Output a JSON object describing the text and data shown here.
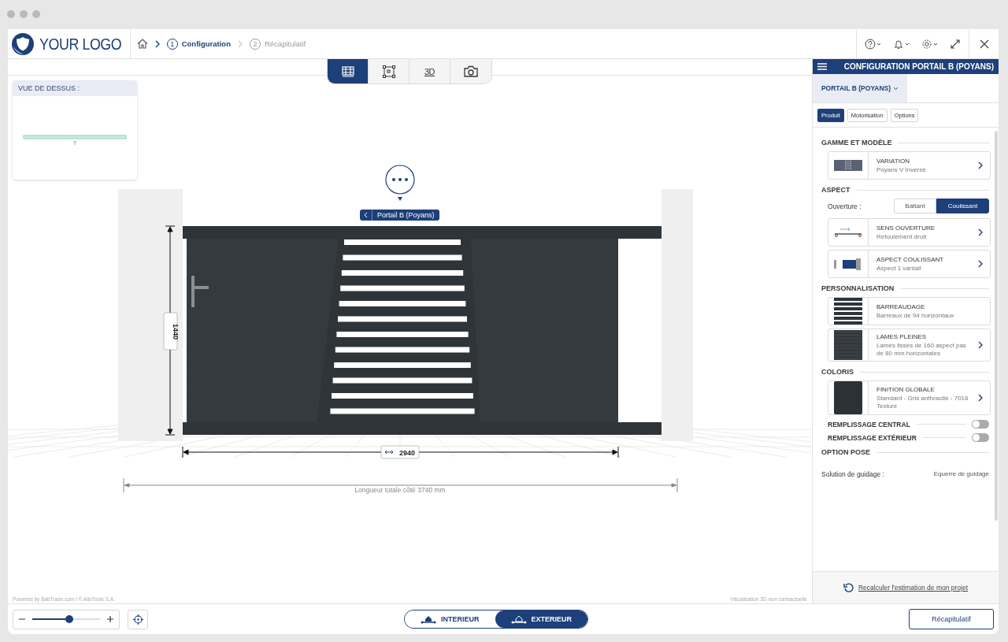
{
  "header": {
    "logo_text": "YOUR LOGO",
    "steps": [
      {
        "number": "1",
        "label": "Configuration",
        "selected": true
      },
      {
        "number": "2",
        "label": "Récapitulatif",
        "selected": false
      }
    ]
  },
  "view_tabs": [
    {
      "kind": "plan",
      "selected": true
    },
    {
      "kind": "frame",
      "selected": false
    },
    {
      "kind": "threed",
      "label": "3D",
      "selected": false
    },
    {
      "kind": "camera",
      "selected": false
    }
  ],
  "minimap": {
    "title": "VUE DE DESSUS :"
  },
  "scene": {
    "element_label": "Portail B (Poyans)",
    "height_dimension": "1440",
    "width_dimension": "2940",
    "total_length": "Longueur totale côté 3740 mm"
  },
  "credits": "Powered by BatiTrade.com / © AlloTools S.A.",
  "disclaimer": "Visualisation 3D non contractuelle",
  "zoom": {
    "level": 0.55
  },
  "side_toggle": [
    {
      "kind": "interior",
      "label": "INTERIEUR",
      "selected": false
    },
    {
      "kind": "exterior",
      "label": "EXTERIEUR",
      "selected": true
    }
  ],
  "panel": {
    "title": "CONFIGURATION PORTAIL B (POYANS)",
    "product_tab": "PORTAIL B (POYANS)",
    "tabs": [
      {
        "label": "Produit",
        "selected": true
      },
      {
        "label": "Motorisation",
        "selected": false
      },
      {
        "label": "Options",
        "selected": false
      }
    ],
    "sections": [
      {
        "title": "GAMME ET MODÈLE",
        "items": [
          {
            "kind": "option",
            "thumbnail": {
              "kind": "variation"
            },
            "title": "VARIATION",
            "value": "Poyans V Inversé",
            "chevron": true
          }
        ]
      },
      {
        "title": "ASPECT",
        "items": [
          {
            "kind": "segmented",
            "label": "Ouverture :",
            "options": [
              {
                "label": "Battant",
                "selected": false
              },
              {
                "label": "Coulissant",
                "selected": true
              }
            ]
          },
          {
            "kind": "option",
            "thumbnail": {
              "kind": "direction"
            },
            "title": "SENS OUVERTURE",
            "value": "Refoulement droit",
            "chevron": true
          },
          {
            "kind": "option",
            "thumbnail": {
              "kind": "sliding"
            },
            "title": "ASPECT COULISSANT",
            "value": "Aspect 1 vantail",
            "chevron": true
          }
        ]
      },
      {
        "title": "PERSONNALISATION",
        "items": [
          {
            "kind": "option",
            "thumbnail": {
              "kind": "bars"
            },
            "title": "BARREAUDAGE",
            "value": "Barreaux de 94 horizontaux",
            "chevron": false
          },
          {
            "kind": "option",
            "thumbnail": {
              "kind": "slats"
            },
            "title": "LAMES PLEINES",
            "value": "Lames lisses de 160 aspect pas de 80 mm horizontales",
            "chevron": true
          }
        ]
      },
      {
        "title": "COLORIS",
        "items": [
          {
            "kind": "option",
            "thumbnail": {
              "kind": "swatch"
            },
            "title": "FINITION GLOBALE",
            "value": "Standard - Gris anthracite - 7016 Texturé",
            "chevron": true
          },
          {
            "kind": "toggle",
            "label": "REMPLISSAGE CENTRAL",
            "on": false
          },
          {
            "kind": "toggle",
            "label": "REMPLISSAGE EXTÉRIEUR",
            "on": false
          }
        ]
      },
      {
        "title": "OPTION POSE",
        "items": [
          {
            "kind": "field",
            "label": "Solution de guidage :",
            "value": "Equerre de guidage"
          }
        ]
      }
    ],
    "recalc_link": "Recalculer l'estimation de mon projet",
    "summary_button": "Récapitulatif"
  }
}
